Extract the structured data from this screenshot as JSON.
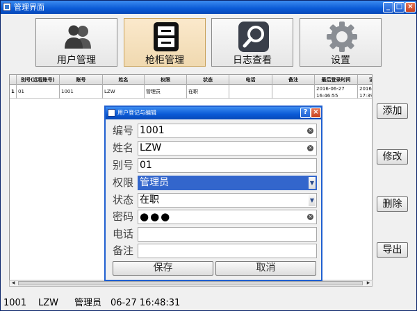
{
  "window": {
    "title": "管理界面"
  },
  "toolbar": [
    {
      "label": "用户管理",
      "icon": "users-icon"
    },
    {
      "label": "枪柜管理",
      "icon": "cabinet-icon"
    },
    {
      "label": "日志查看",
      "icon": "search-icon"
    },
    {
      "label": "设置",
      "icon": "gear-icon"
    }
  ],
  "table": {
    "columns": [
      "别号(远程账号)",
      "账号",
      "姓名",
      "权限",
      "状态",
      "电话",
      "备注",
      "最后登录时间",
      "证"
    ],
    "rows": [
      {
        "index": "1",
        "cells": [
          "01",
          "1001",
          "LZW",
          "管理员",
          "在职",
          "",
          "",
          "2016-06-27 16:46:55",
          "2016-0 17:39:"
        ]
      }
    ]
  },
  "side_buttons": [
    "添加",
    "修改",
    "删除",
    "导出"
  ],
  "status": {
    "account": "1001",
    "name": "LZW",
    "role": "管理员",
    "time": "06-27 16:48:31"
  },
  "dialog": {
    "title": "用户登记与编辑",
    "fields": [
      {
        "label": "编号",
        "value": "1001"
      },
      {
        "label": "姓名",
        "value": "LZW"
      },
      {
        "label": "别号",
        "value": "01"
      },
      {
        "label": "权限",
        "value": "管理员"
      },
      {
        "label": "状态",
        "value": "在职"
      },
      {
        "label": "密码",
        "value": "●●●"
      },
      {
        "label": "电话",
        "value": ""
      },
      {
        "label": "备注",
        "value": ""
      }
    ],
    "save_label": "保存",
    "cancel_label": "取消"
  },
  "colors": {
    "titlebar": "#0a5ad6",
    "selection": "#3366cc",
    "active_tab": "#f0d9b0"
  }
}
